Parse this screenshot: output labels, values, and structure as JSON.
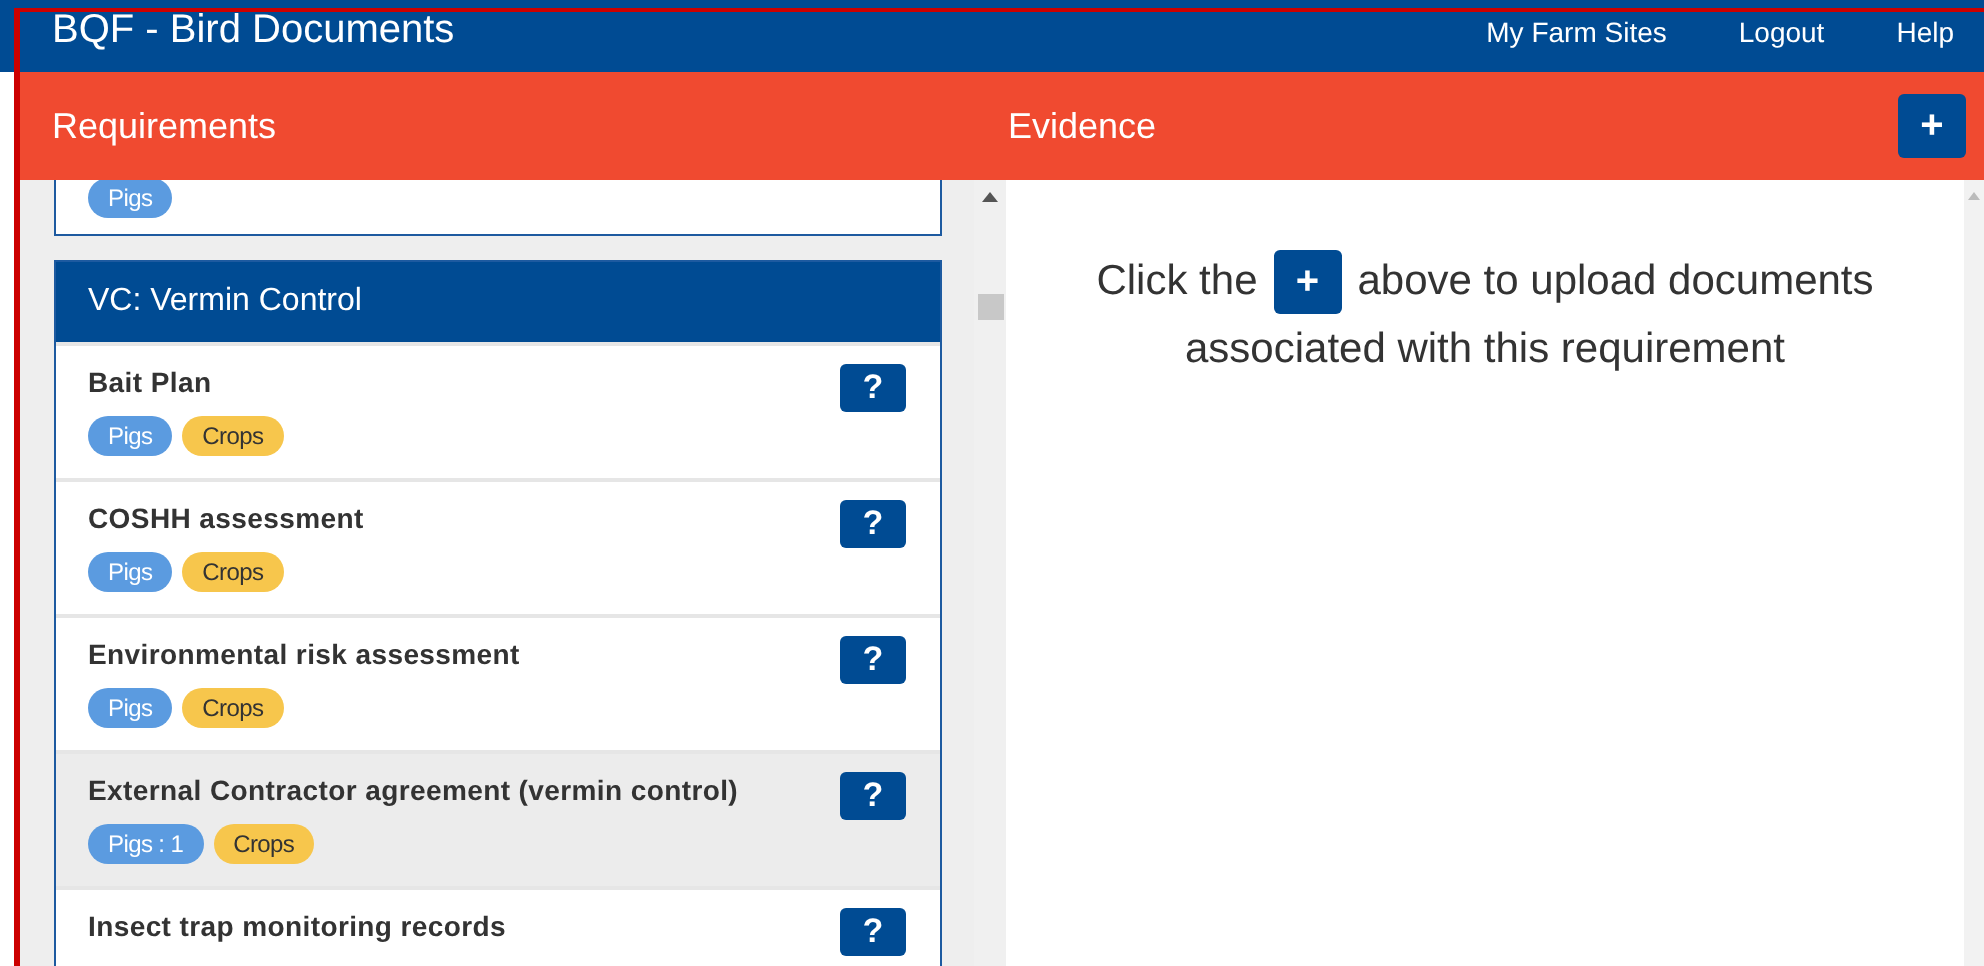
{
  "navbar": {
    "title": "BQF - Bird Documents",
    "links": [
      "My Farm Sites",
      "Logout",
      "Help"
    ]
  },
  "requirements": {
    "heading": "Requirements",
    "previous_card": {
      "tags": [
        {
          "label": "Pigs",
          "color": "#5b9be0"
        }
      ]
    },
    "group": {
      "title": "VC: Vermin Control",
      "items": [
        {
          "name": "Bait Plan",
          "selected": false,
          "help": "?",
          "tags": [
            {
              "label": "Pigs",
              "color": "#5b9be0"
            },
            {
              "label": "Crops",
              "color": "#f7c64c"
            }
          ]
        },
        {
          "name": "COSHH assessment",
          "selected": false,
          "help": "?",
          "tags": [
            {
              "label": "Pigs",
              "color": "#5b9be0"
            },
            {
              "label": "Crops",
              "color": "#f7c64c"
            }
          ]
        },
        {
          "name": "Environmental risk assessment",
          "selected": false,
          "help": "?",
          "tags": [
            {
              "label": "Pigs",
              "color": "#5b9be0"
            },
            {
              "label": "Crops",
              "color": "#f7c64c"
            }
          ]
        },
        {
          "name": "External Contractor agreement (vermin control)",
          "selected": true,
          "help": "?",
          "tags": [
            {
              "label": "Pigs : 1",
              "color": "#5b9be0"
            },
            {
              "label": "Crops",
              "color": "#f7c64c"
            }
          ]
        },
        {
          "name": "Insect trap monitoring records",
          "selected": false,
          "help": "?"
        }
      ]
    }
  },
  "evidence": {
    "heading": "Evidence",
    "add_button": "+",
    "message_before": "Click the",
    "message_button": "+",
    "message_after": "above to upload documents",
    "message_line2": "associated with this requirement"
  }
}
